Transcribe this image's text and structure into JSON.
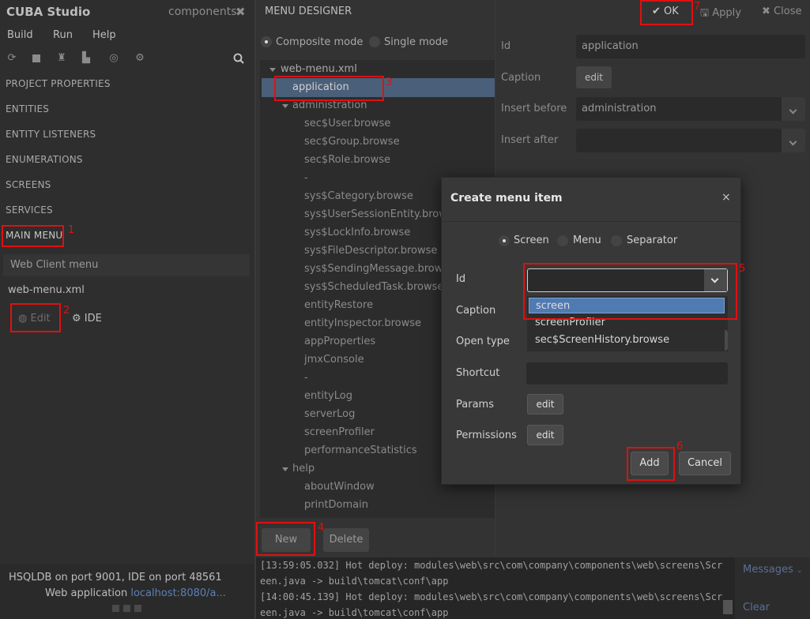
{
  "left": {
    "app_title": "CUBA Studio",
    "project_name": "components",
    "close_glyph": "✖",
    "menu": [
      "Build",
      "Run",
      "Help"
    ],
    "toolbar_icons": [
      "refresh-icon",
      "stop-icon",
      "brush-icon",
      "hierarchy-icon",
      "check-icon",
      "deploy-icon",
      "search-icon"
    ],
    "nav": [
      "PROJECT PROPERTIES",
      "ENTITIES",
      "ENTITY LISTENERS",
      "ENUMERATIONS",
      "SCREENS",
      "SERVICES",
      "MAIN MENU"
    ],
    "web_client_menu": "Web Client menu",
    "menu_file": "web-menu.xml",
    "edit_label": "Edit",
    "ide_label": "IDE",
    "status_line1": "HSQLDB   on port 9001,  IDE   on port 48561",
    "status_line2_prefix": "Web application ",
    "status_link": "localhost:8080/a..."
  },
  "designer": {
    "title": "MENU DESIGNER",
    "composite_mode": "Composite mode",
    "single_mode": "Single mode",
    "tree": {
      "root": "web-menu.xml",
      "selected": "application",
      "group1": "administration",
      "group1_items": [
        "sec$User.browse",
        "sec$Group.browse",
        "sec$Role.browse",
        "-",
        "sys$Category.browse",
        "sys$UserSessionEntity.browse",
        "sys$LockInfo.browse",
        "sys$FileDescriptor.browse",
        "sys$SendingMessage.browse",
        "sys$ScheduledTask.browse",
        "entityRestore",
        "entityInspector.browse",
        "appProperties",
        "jmxConsole",
        "-",
        "entityLog",
        "serverLog",
        "screenProfiler",
        "performanceStatistics"
      ],
      "group2": "help",
      "group2_items": [
        "aboutWindow",
        "printDomain"
      ]
    },
    "new_button": "New",
    "delete_button": "Delete"
  },
  "properties": {
    "ok": "OK",
    "apply": "Apply",
    "close": "Close",
    "id_label": "Id",
    "id_value": "application",
    "caption_label": "Caption",
    "caption_button": "edit",
    "insert_before_label": "Insert before",
    "insert_before_value": "administration",
    "insert_after_label": "Insert after",
    "insert_after_value": ""
  },
  "dialog": {
    "title": "Create menu item",
    "close_glyph": "×",
    "type_options": [
      "Screen",
      "Menu",
      "Separator"
    ],
    "selected_type": "Screen",
    "id_label": "Id",
    "id_value": "",
    "id_suggestions": [
      "screen",
      "screenProfiler",
      "sec$ScreenHistory.browse"
    ],
    "caption_label": "Caption",
    "open_type_label": "Open type",
    "shortcut_label": "Shortcut",
    "params_label": "Params",
    "params_button": "edit",
    "permissions_label": "Permissions",
    "permissions_button": "edit",
    "add_button": "Add",
    "cancel_button": "Cancel"
  },
  "console": {
    "lines": [
      "[13:59:05.032] Hot deploy: modules\\web\\src\\com\\company\\components\\web\\screens\\Scr",
      "een.java -> build\\tomcat\\conf\\app",
      "[14:00:45.139] Hot deploy: modules\\web\\src\\com\\company\\components\\web\\screens\\Scr",
      "een.java -> build\\tomcat\\conf\\app"
    ],
    "messages_label": "Messages",
    "clear_label": "Clear"
  },
  "annotations": [
    "1",
    "2",
    "3",
    "4",
    "5",
    "6",
    "7"
  ],
  "colors": {
    "highlight": "#e01010",
    "selection": "#4a5f79",
    "suggest_hl": "#4f7ab2",
    "link": "#5b80b8"
  }
}
